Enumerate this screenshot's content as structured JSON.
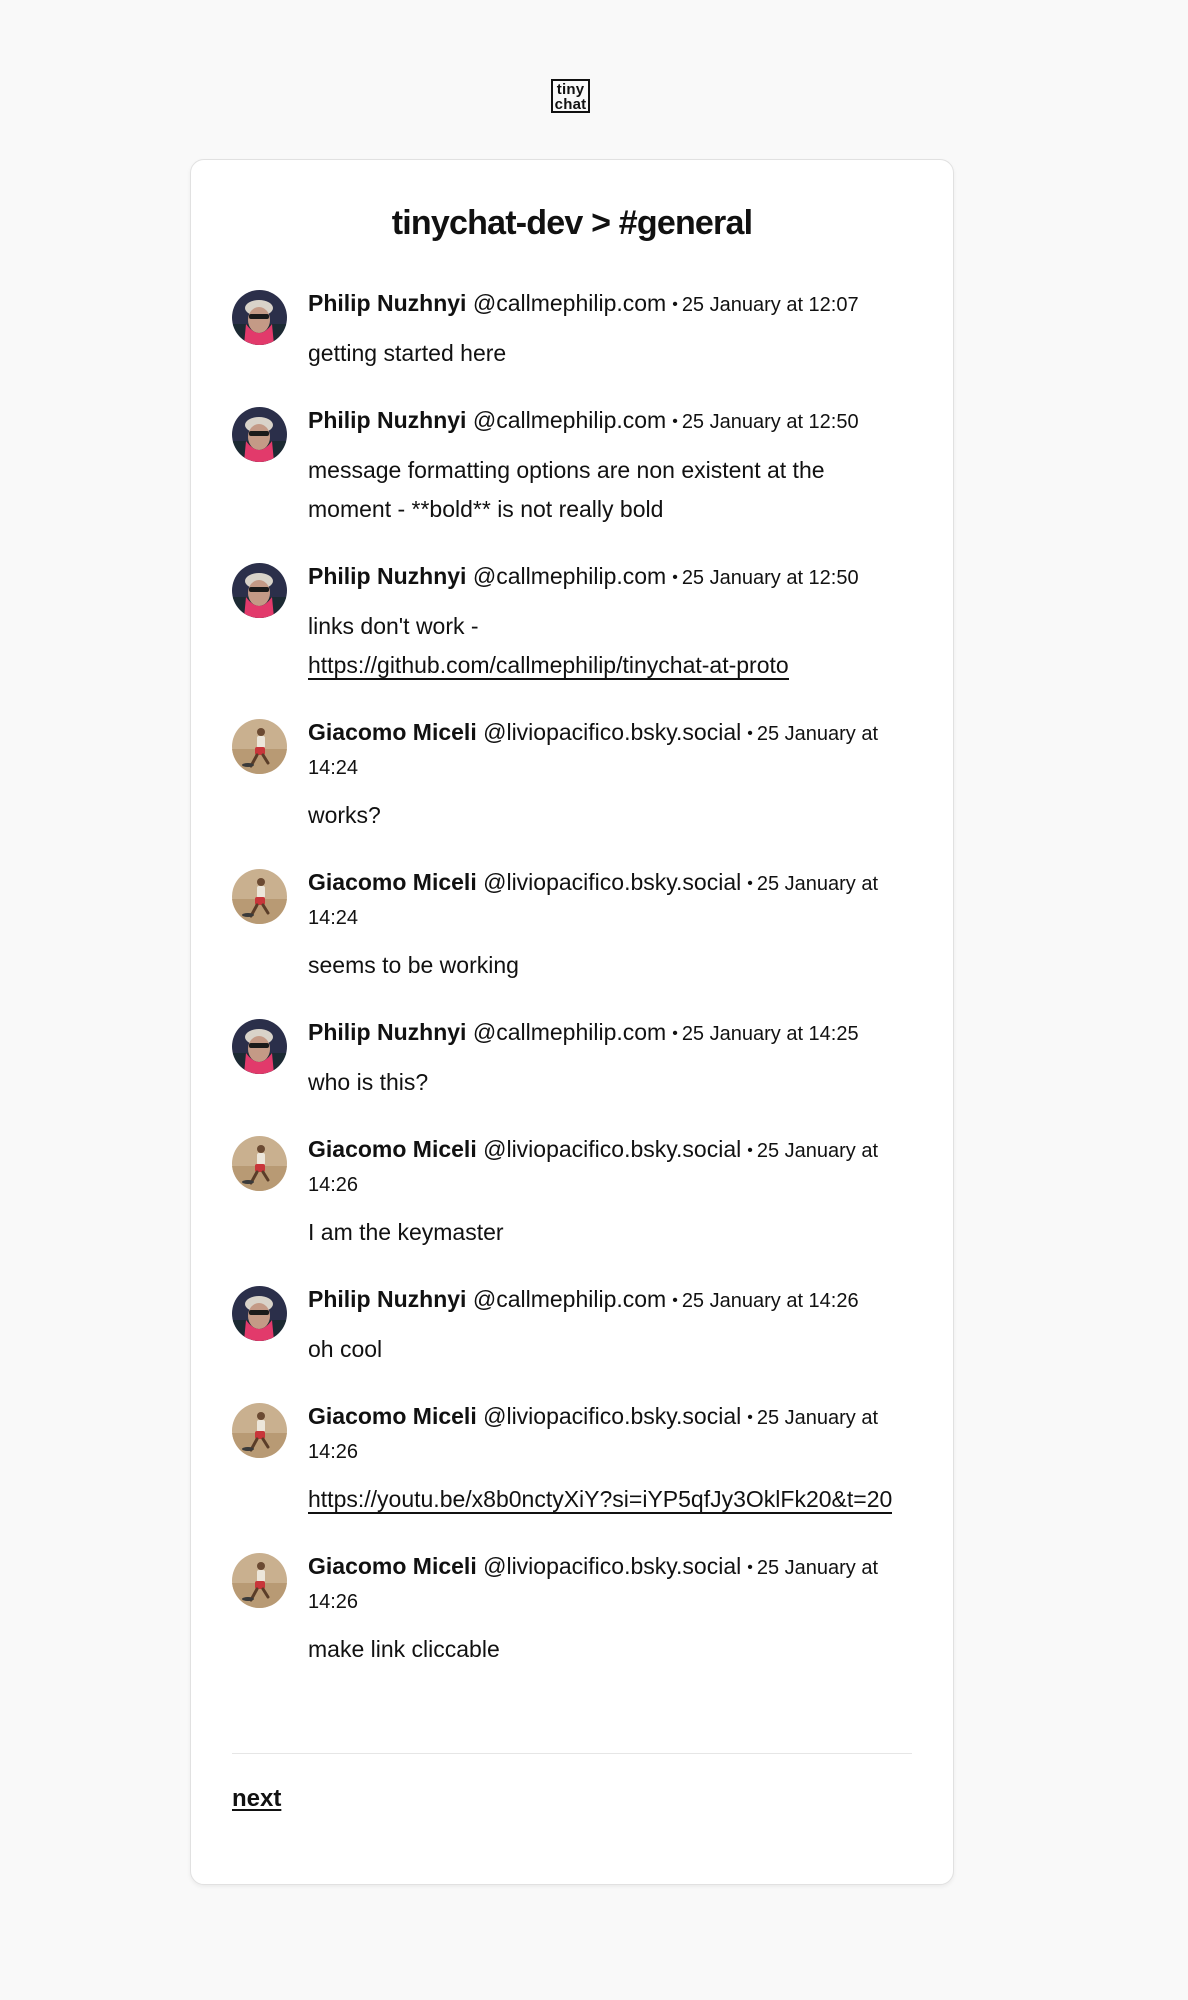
{
  "logo": {
    "line1": "tiny",
    "line2": "chat"
  },
  "title": "tinychat-dev > #general",
  "messages": [
    {
      "author": "Philip Nuzhnyi",
      "handle": "@callmephilip.com",
      "separator": "•",
      "time": "25 January at 12:07",
      "avatar": "philip-avatar",
      "text": "getting started here"
    },
    {
      "author": "Philip Nuzhnyi",
      "handle": "@callmephilip.com",
      "separator": "•",
      "time": "25 January at 12:50",
      "avatar": "philip-avatar",
      "text": "message formatting options are non existent at the moment - **bold** is not really bold"
    },
    {
      "author": "Philip Nuzhnyi",
      "handle": "@callmephilip.com",
      "separator": "•",
      "time": "25 January at 12:50",
      "avatar": "philip-avatar",
      "text": "links don't work -",
      "link": "https://github.com/callmephilip/tinychat-at-proto"
    },
    {
      "author": "Giacomo Miceli",
      "handle": "@liviopacifico.bsky.social",
      "separator": "•",
      "time": "25 January at 14:24",
      "avatar": "giacomo-avatar",
      "text": "works?"
    },
    {
      "author": "Giacomo Miceli",
      "handle": "@liviopacifico.bsky.social",
      "separator": "•",
      "time": "25 January at 14:24",
      "avatar": "giacomo-avatar",
      "text": "seems to be working"
    },
    {
      "author": "Philip Nuzhnyi",
      "handle": "@callmephilip.com",
      "separator": "•",
      "time": "25 January at 14:25",
      "avatar": "philip-avatar",
      "text": "who is this?"
    },
    {
      "author": "Giacomo Miceli",
      "handle": "@liviopacifico.bsky.social",
      "separator": "•",
      "time": "25 January at 14:26",
      "avatar": "giacomo-avatar",
      "text": "I am the keymaster"
    },
    {
      "author": "Philip Nuzhnyi",
      "handle": "@callmephilip.com",
      "separator": "•",
      "time": "25 January at 14:26",
      "avatar": "philip-avatar",
      "text": "oh cool"
    },
    {
      "author": "Giacomo Miceli",
      "handle": "@liviopacifico.bsky.social",
      "separator": "•",
      "time": "25 January at 14:26",
      "avatar": "giacomo-avatar",
      "text": "",
      "link": "https://youtu.be/x8b0nctyXiY?si=iYP5qfJy3OklFk20&t=20"
    },
    {
      "author": "Giacomo Miceli",
      "handle": "@liviopacifico.bsky.social",
      "separator": "•",
      "time": "25 January at 14:26",
      "avatar": "giacomo-avatar",
      "text": "make link cliccable"
    }
  ],
  "pagination": {
    "next_label": "next"
  },
  "colors": {
    "background": "#f9f9f9",
    "card": "#ffffff",
    "text": "#111111",
    "border": "#e1e1e1"
  }
}
